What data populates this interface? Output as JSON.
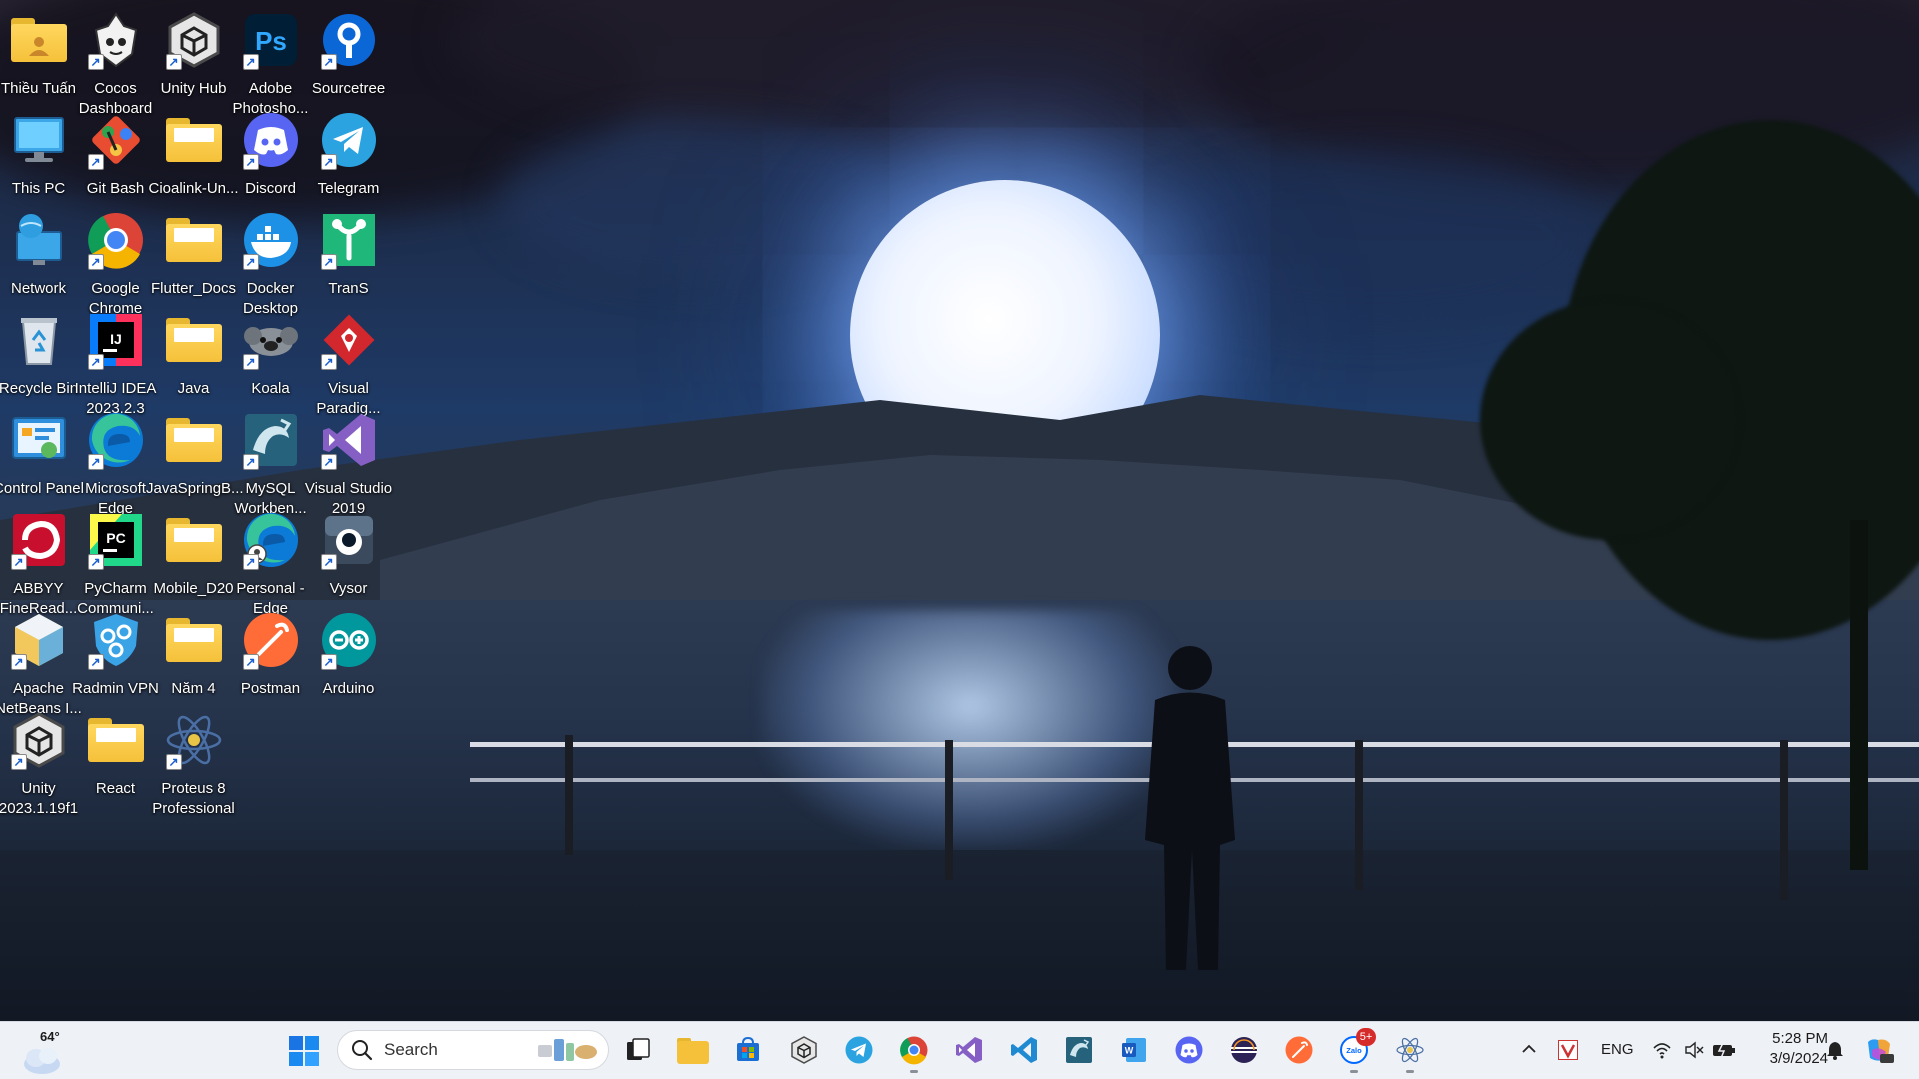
{
  "desktop": {
    "icons": [
      {
        "label": "Thiều Tuấn",
        "icon": "user-folder-icon"
      },
      {
        "label": "Cocos Dashboard",
        "icon": "cocos-icon"
      },
      {
        "label": "Unity Hub",
        "icon": "unity-hub-icon"
      },
      {
        "label": "Adobe Photosho...",
        "icon": "photoshop-icon"
      },
      {
        "label": "Sourcetree",
        "icon": "sourcetree-icon"
      },
      {
        "label": "This PC",
        "icon": "monitor-icon"
      },
      {
        "label": "Git Bash",
        "icon": "git-bash-icon"
      },
      {
        "label": "Cioalink-Un...",
        "icon": "folder-icon"
      },
      {
        "label": "Discord",
        "icon": "discord-icon"
      },
      {
        "label": "Telegram",
        "icon": "telegram-icon"
      },
      {
        "label": "Network",
        "icon": "network-icon"
      },
      {
        "label": "Google Chrome",
        "icon": "chrome-icon"
      },
      {
        "label": "Flutter_Docs",
        "icon": "folder-icon"
      },
      {
        "label": "Docker Desktop",
        "icon": "docker-icon"
      },
      {
        "label": "TranS",
        "icon": "trans-icon"
      },
      {
        "label": "Recycle Bin",
        "icon": "recycle-bin-icon"
      },
      {
        "label": "IntelliJ IDEA 2023.2.3",
        "icon": "intellij-icon"
      },
      {
        "label": "Java",
        "icon": "folder-icon"
      },
      {
        "label": "Koala",
        "icon": "koala-icon"
      },
      {
        "label": "Visual Paradig...",
        "icon": "visual-paradigm-icon"
      },
      {
        "label": "Control Panel",
        "icon": "control-panel-icon"
      },
      {
        "label": "Microsoft Edge",
        "icon": "edge-icon"
      },
      {
        "label": "JavaSpringB...",
        "icon": "folder-icon"
      },
      {
        "label": "MySQL Workben...",
        "icon": "mysql-workbench-icon"
      },
      {
        "label": "Visual Studio 2019",
        "icon": "visual-studio-icon"
      },
      {
        "label": "ABBYY FineRead...",
        "icon": "abbyy-icon"
      },
      {
        "label": "PyCharm Communi...",
        "icon": "pycharm-icon"
      },
      {
        "label": "Mobile_D20",
        "icon": "folder-icon"
      },
      {
        "label": "Personal - Edge",
        "icon": "edge-profile-icon"
      },
      {
        "label": "Vysor",
        "icon": "vysor-icon"
      },
      {
        "label": "Apache NetBeans I...",
        "icon": "netbeans-icon"
      },
      {
        "label": "Radmin VPN",
        "icon": "radmin-vpn-icon"
      },
      {
        "label": "Năm 4",
        "icon": "folder-icon"
      },
      {
        "label": "Postman",
        "icon": "postman-icon"
      },
      {
        "label": "Arduino",
        "icon": "arduino-icon"
      },
      {
        "label": "Unity 2023.1.19f1",
        "icon": "unity-icon"
      },
      {
        "label": "React",
        "icon": "folder-icon"
      },
      {
        "label": "Proteus 8 Professional",
        "icon": "proteus-icon"
      }
    ]
  },
  "taskbar": {
    "weather": {
      "temp": "64°",
      "icon": "weather-cloud-icon"
    },
    "search": {
      "placeholder": "Search"
    },
    "apps": [
      {
        "name": "start-button",
        "icon": "windows-start-icon"
      },
      {
        "name": "task-view",
        "icon": "task-view-icon"
      },
      {
        "name": "file-explorer",
        "icon": "folder-icon"
      },
      {
        "name": "microsoft-store",
        "icon": "store-icon"
      },
      {
        "name": "unity-hub",
        "icon": "unity-hub-icon"
      },
      {
        "name": "telegram",
        "icon": "telegram-icon"
      },
      {
        "name": "chrome",
        "icon": "chrome-icon"
      },
      {
        "name": "visual-studio",
        "icon": "visual-studio-icon"
      },
      {
        "name": "vs-code",
        "icon": "vscode-icon"
      },
      {
        "name": "mysql-workbench",
        "icon": "mysql-workbench-icon"
      },
      {
        "name": "word",
        "icon": "word-icon"
      },
      {
        "name": "discord",
        "icon": "discord-icon"
      },
      {
        "name": "eclipse",
        "icon": "eclipse-icon"
      },
      {
        "name": "postman",
        "icon": "postman-icon"
      },
      {
        "name": "zalo",
        "icon": "zalo-icon",
        "badge": "5+"
      },
      {
        "name": "proteus",
        "icon": "proteus-icon"
      }
    ],
    "tray": {
      "language": "ENG",
      "time": "5:28 PM",
      "date": "3/9/2024"
    }
  },
  "colors": {
    "taskbar_bg": "#eef1f6",
    "folder_yellow": "#f5c13a",
    "badge_red": "#d62b2b"
  }
}
